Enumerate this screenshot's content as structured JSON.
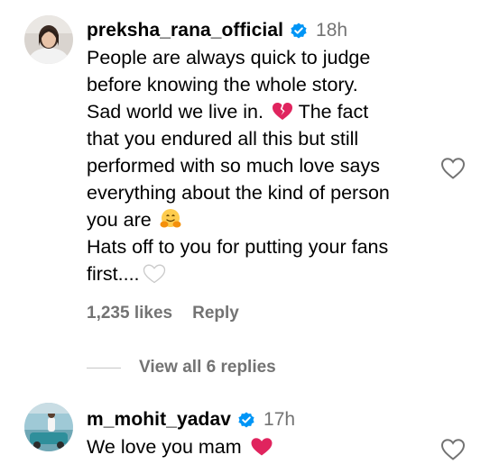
{
  "comments": [
    {
      "username": "preksha_rana_official",
      "time": "18h",
      "verified_icon": "verified-badge-icon",
      "text_lines": [
        "People are always quick to judge",
        "before knowing the whole story.",
        "Sad world we live in.",
        "The fact",
        "that you endured all this but still",
        "performed with so much love says",
        "everything about the kind of person",
        "you are",
        "Hats off to you for putting your fans",
        "first...."
      ],
      "likes": "1,235 likes",
      "reply_label": "Reply"
    },
    {
      "username": "m_mohit_yadav",
      "time": "17h",
      "verified_icon": "verified-badge-icon",
      "text": "We love you mam"
    }
  ],
  "view_replies_label": "View all 6 replies",
  "colors": {
    "verified": "#0095f6",
    "secondary_text": "#737373",
    "heart_red": "#e0245e"
  }
}
